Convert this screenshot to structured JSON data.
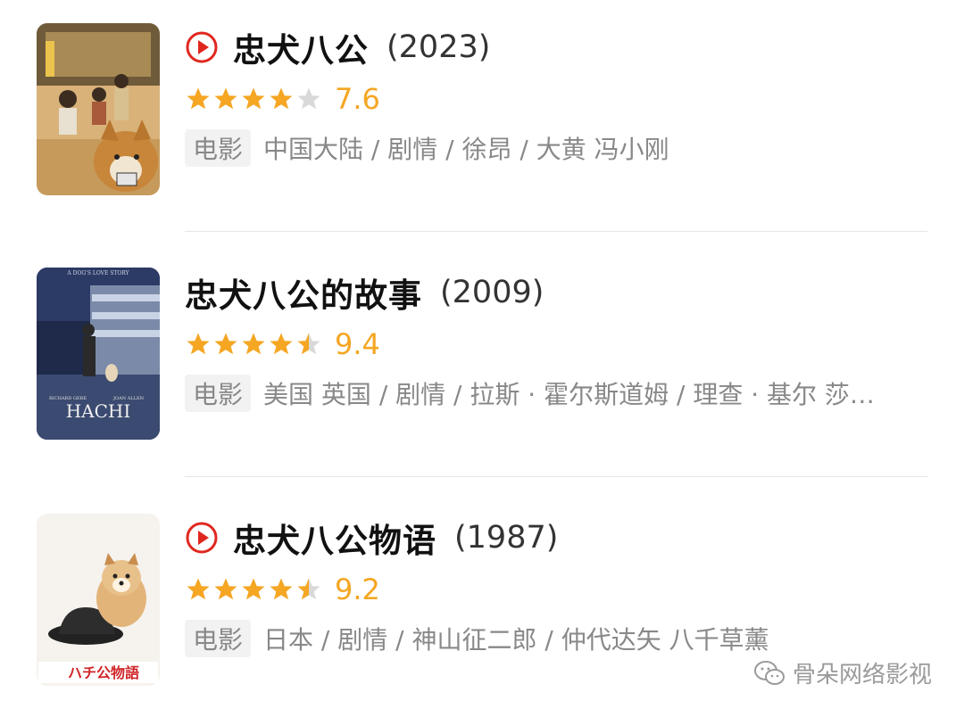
{
  "colors": {
    "star": "#f5a623",
    "star_empty": "#d9d9d9",
    "play": "#e0271f",
    "meta": "#888888"
  },
  "movies": [
    {
      "title": "忠犬八公",
      "year": "(2023)",
      "has_play_icon": true,
      "rating": 7.6,
      "rating_text": "7.6",
      "stars": [
        "full",
        "full",
        "full",
        "full",
        "empty"
      ],
      "tag": "电影",
      "meta": "中国大陆 / 剧情 / 徐昂 / 大黄 冯小刚"
    },
    {
      "title": "忠犬八公的故事",
      "year": "(2009)",
      "has_play_icon": false,
      "rating": 9.4,
      "rating_text": "9.4",
      "stars": [
        "full",
        "full",
        "full",
        "full",
        "half"
      ],
      "tag": "电影",
      "meta": "美国 英国 / 剧情 / 拉斯 · 霍尔斯道姆 / 理查 · 基尔 莎…"
    },
    {
      "title": "忠犬八公物语",
      "year": "(1987)",
      "has_play_icon": true,
      "rating": 9.2,
      "rating_text": "9.2",
      "stars": [
        "full",
        "full",
        "full",
        "full",
        "half"
      ],
      "tag": "电影",
      "meta": "日本 / 剧情 / 神山征二郎 / 仲代达矢 八千草薰"
    }
  ],
  "posters": {
    "p2_top": "A DOG'S LOVE STORY",
    "p2_credit_left": "RICHARD GERE",
    "p2_credit_right": "JOAN ALLEN",
    "p2_title": "HACHI",
    "p3_title": "ハチ公物語"
  },
  "watermark": {
    "icon": "wechat-icon",
    "text": "骨朵网络影视"
  }
}
